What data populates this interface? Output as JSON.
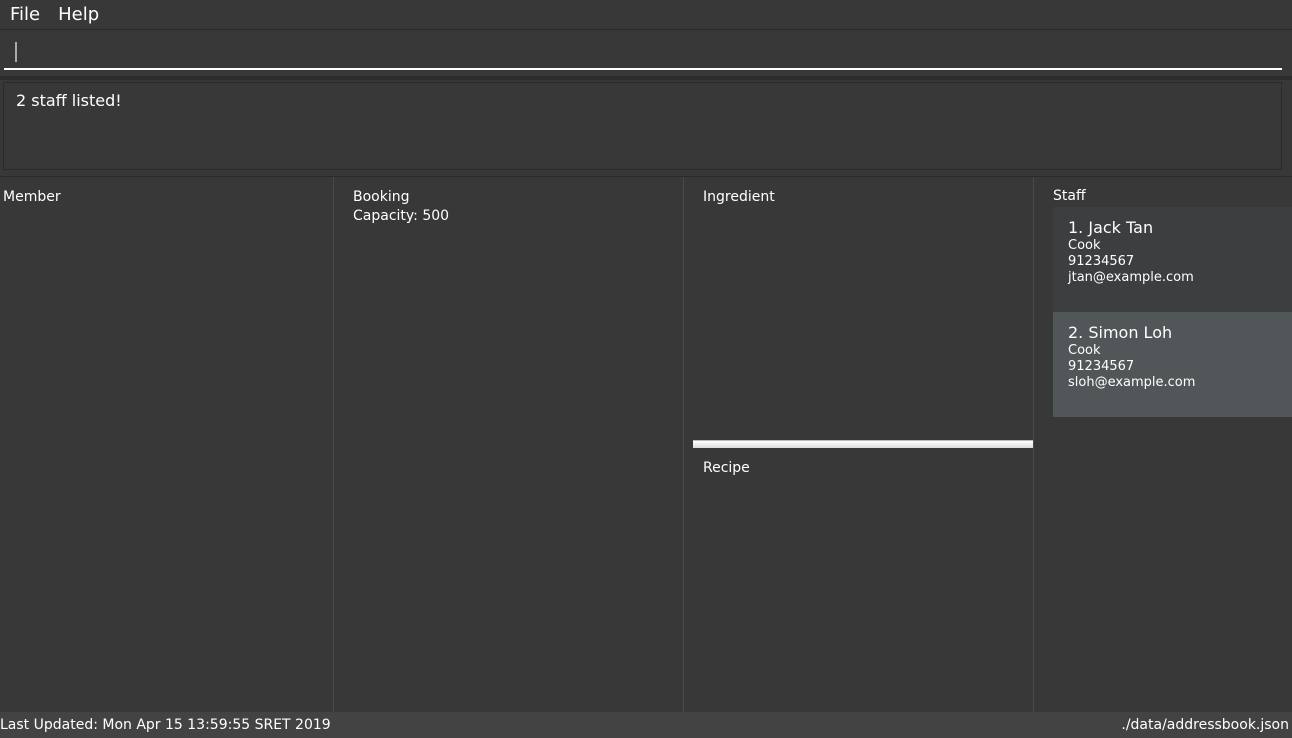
{
  "menu": {
    "file": "File",
    "help": "Help"
  },
  "command": {
    "value": ""
  },
  "result": "2 staff listed!",
  "panels": {
    "member": "Member",
    "booking": "Booking",
    "capacity": "Capacity: 500",
    "ingredient": "Ingredient",
    "recipe": "Recipe",
    "staff": "Staff"
  },
  "staff": [
    {
      "name": "1.  Jack Tan",
      "role": "Cook",
      "phone": "91234567",
      "email": "jtan@example.com"
    },
    {
      "name": "2.  Simon Loh",
      "role": "Cook",
      "phone": "91234567",
      "email": "sloh@example.com"
    }
  ],
  "status": {
    "updated": "Last Updated: Mon Apr 15 13:59:55 SRET 2019",
    "path": "./data/addressbook.json"
  }
}
